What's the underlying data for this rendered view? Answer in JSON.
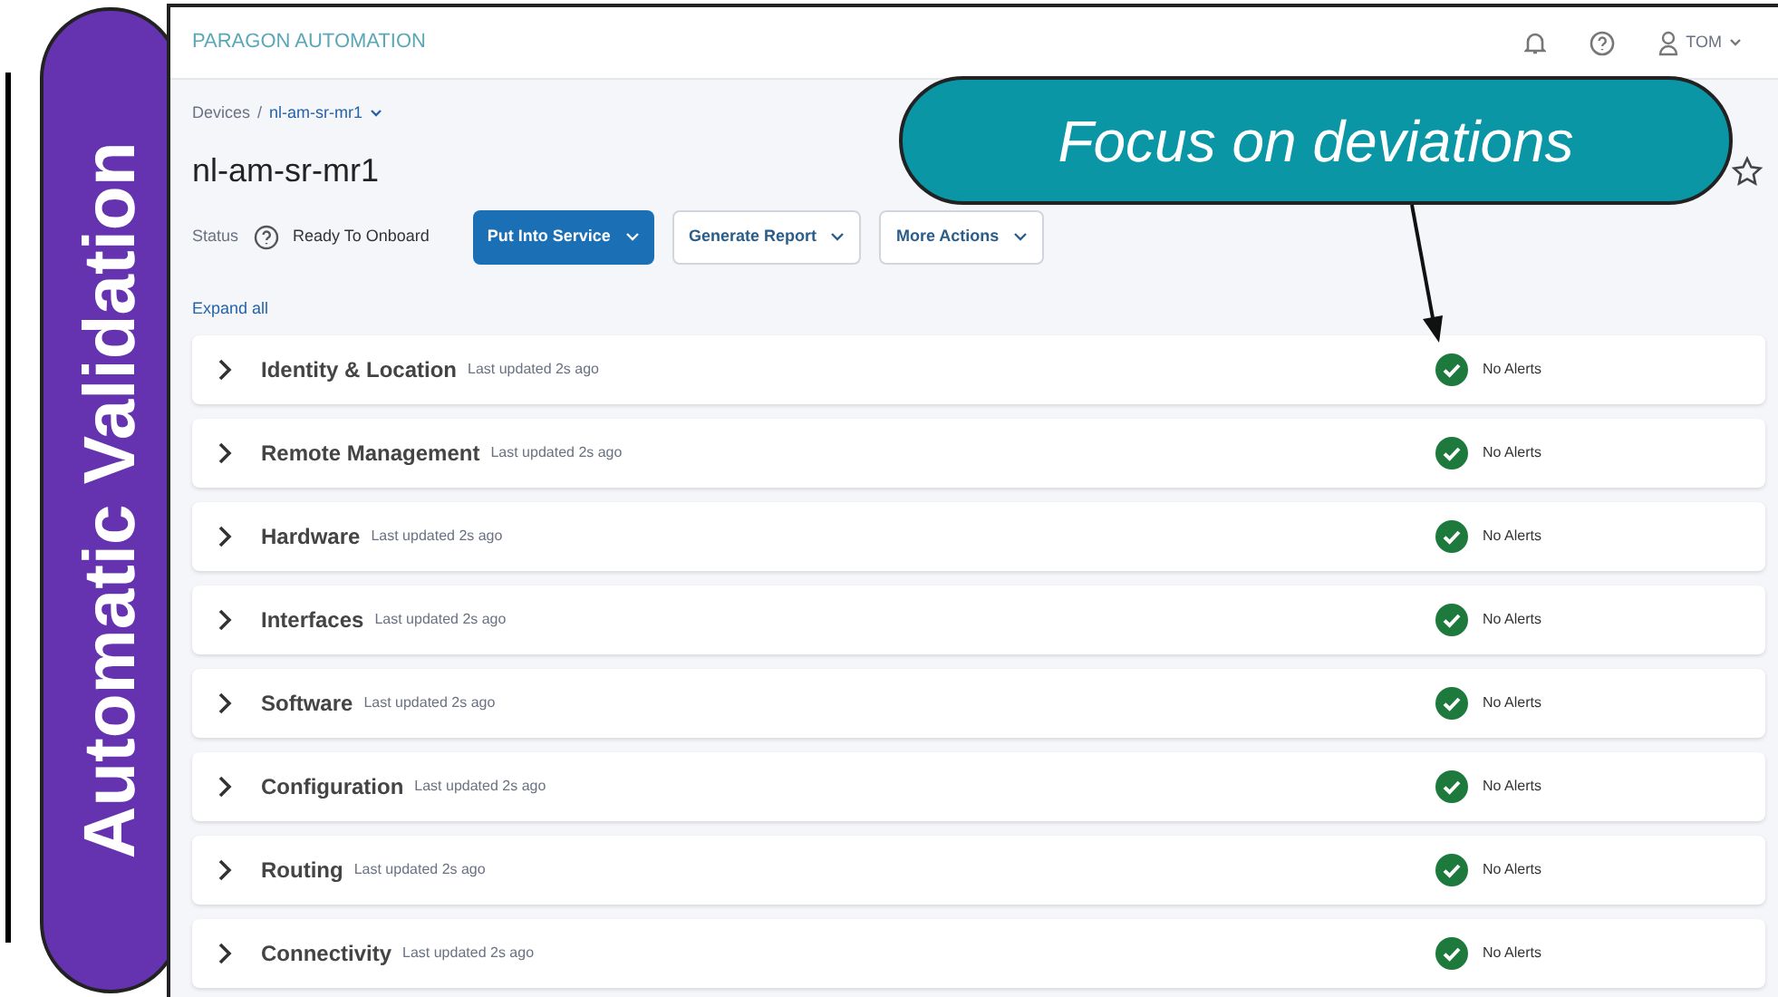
{
  "side_label": {
    "text": "Automatic Validation"
  },
  "callout": {
    "text": "Focus on deviations"
  },
  "header": {
    "brand": "PARAGON AUTOMATION",
    "user": "TOM"
  },
  "breadcrumb": {
    "parent": "Devices",
    "separator": "/",
    "current": "nl-am-sr-mr1"
  },
  "device": {
    "name": "nl-am-sr-mr1",
    "status_label": "Status",
    "status": "Ready To Onboard"
  },
  "actions": [
    {
      "label": "Put Into Service",
      "primary": true
    },
    {
      "label": "Generate Report",
      "primary": false
    },
    {
      "label": "More Actions",
      "primary": false
    }
  ],
  "expand_all": "Expand all",
  "sections": [
    {
      "title": "Identity & Location",
      "updated": "Last updated 2s ago",
      "alerts": "No Alerts"
    },
    {
      "title": "Remote Management",
      "updated": "Last updated 2s ago",
      "alerts": "No Alerts"
    },
    {
      "title": "Hardware",
      "updated": "Last updated 2s ago",
      "alerts": "No Alerts"
    },
    {
      "title": "Interfaces",
      "updated": "Last updated 2s ago",
      "alerts": "No Alerts"
    },
    {
      "title": "Software",
      "updated": "Last updated 2s ago",
      "alerts": "No Alerts"
    },
    {
      "title": "Configuration",
      "updated": "Last updated 2s ago",
      "alerts": "No Alerts"
    },
    {
      "title": "Routing",
      "updated": "Last updated 2s ago",
      "alerts": "No Alerts"
    },
    {
      "title": "Connectivity",
      "updated": "Last updated 2s ago",
      "alerts": "No Alerts"
    }
  ]
}
